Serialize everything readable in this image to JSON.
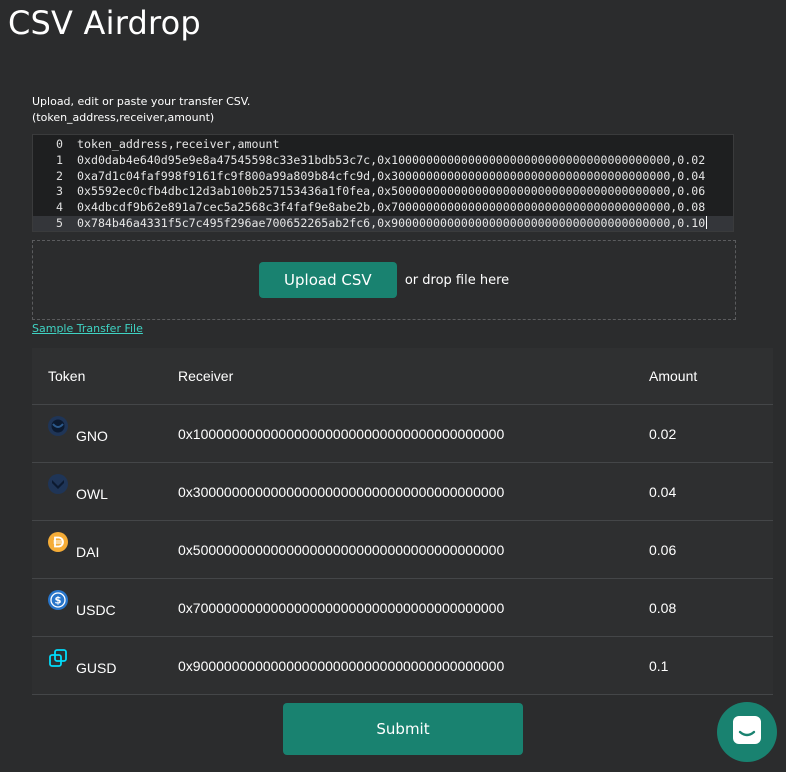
{
  "page": {
    "title": "CSV Airdrop",
    "instructions_line1": "Upload, edit or paste your transfer CSV.",
    "instructions_line2": "(token_address,receiver,amount)"
  },
  "editor": {
    "lines": [
      {
        "num": "0",
        "text": "token_address,receiver,amount"
      },
      {
        "num": "1",
        "text": "0xd0dab4e640d95e9e8a47545598c33e31bdb53c7c,0x1000000000000000000000000000000000000000,0.02"
      },
      {
        "num": "2",
        "text": "0xa7d1c04faf998f9161fc9f800a99a809b84cfc9d,0x3000000000000000000000000000000000000000,0.04"
      },
      {
        "num": "3",
        "text": "0x5592ec0cfb4dbc12d3ab100b257153436a1f0fea,0x5000000000000000000000000000000000000000,0.06"
      },
      {
        "num": "4",
        "text": "0x4dbcdf9b62e891a7cec5a2568c3f4faf9e8abe2b,0x7000000000000000000000000000000000000000,0.08"
      },
      {
        "num": "5",
        "text": "0x784b46a4331f5c7c495f296ae700652265ab2fc6,0x9000000000000000000000000000000000000000,0.10"
      }
    ]
  },
  "dropzone": {
    "upload_label": "Upload CSV",
    "drop_text": "or drop file here"
  },
  "sample_link": "Sample Transfer File",
  "table": {
    "headers": {
      "token": "Token",
      "receiver": "Receiver",
      "amount": "Amount"
    },
    "rows": [
      {
        "token": "GNO",
        "icon": "gno-token-icon",
        "receiver": "0x1000000000000000000000000000000000000000",
        "amount": "0.02"
      },
      {
        "token": "OWL",
        "icon": "owl-token-icon",
        "receiver": "0x3000000000000000000000000000000000000000",
        "amount": "0.04"
      },
      {
        "token": "DAI",
        "icon": "dai-token-icon",
        "receiver": "0x5000000000000000000000000000000000000000",
        "amount": "0.06"
      },
      {
        "token": "USDC",
        "icon": "usdc-token-icon",
        "receiver": "0x7000000000000000000000000000000000000000",
        "amount": "0.08"
      },
      {
        "token": "GUSD",
        "icon": "gusd-token-icon",
        "receiver": "0x9000000000000000000000000000000000000000",
        "amount": "0.1"
      }
    ]
  },
  "submit_label": "Submit",
  "colors": {
    "background": "#2b2c2d",
    "accent": "#198270",
    "link": "#3fd3c3"
  }
}
